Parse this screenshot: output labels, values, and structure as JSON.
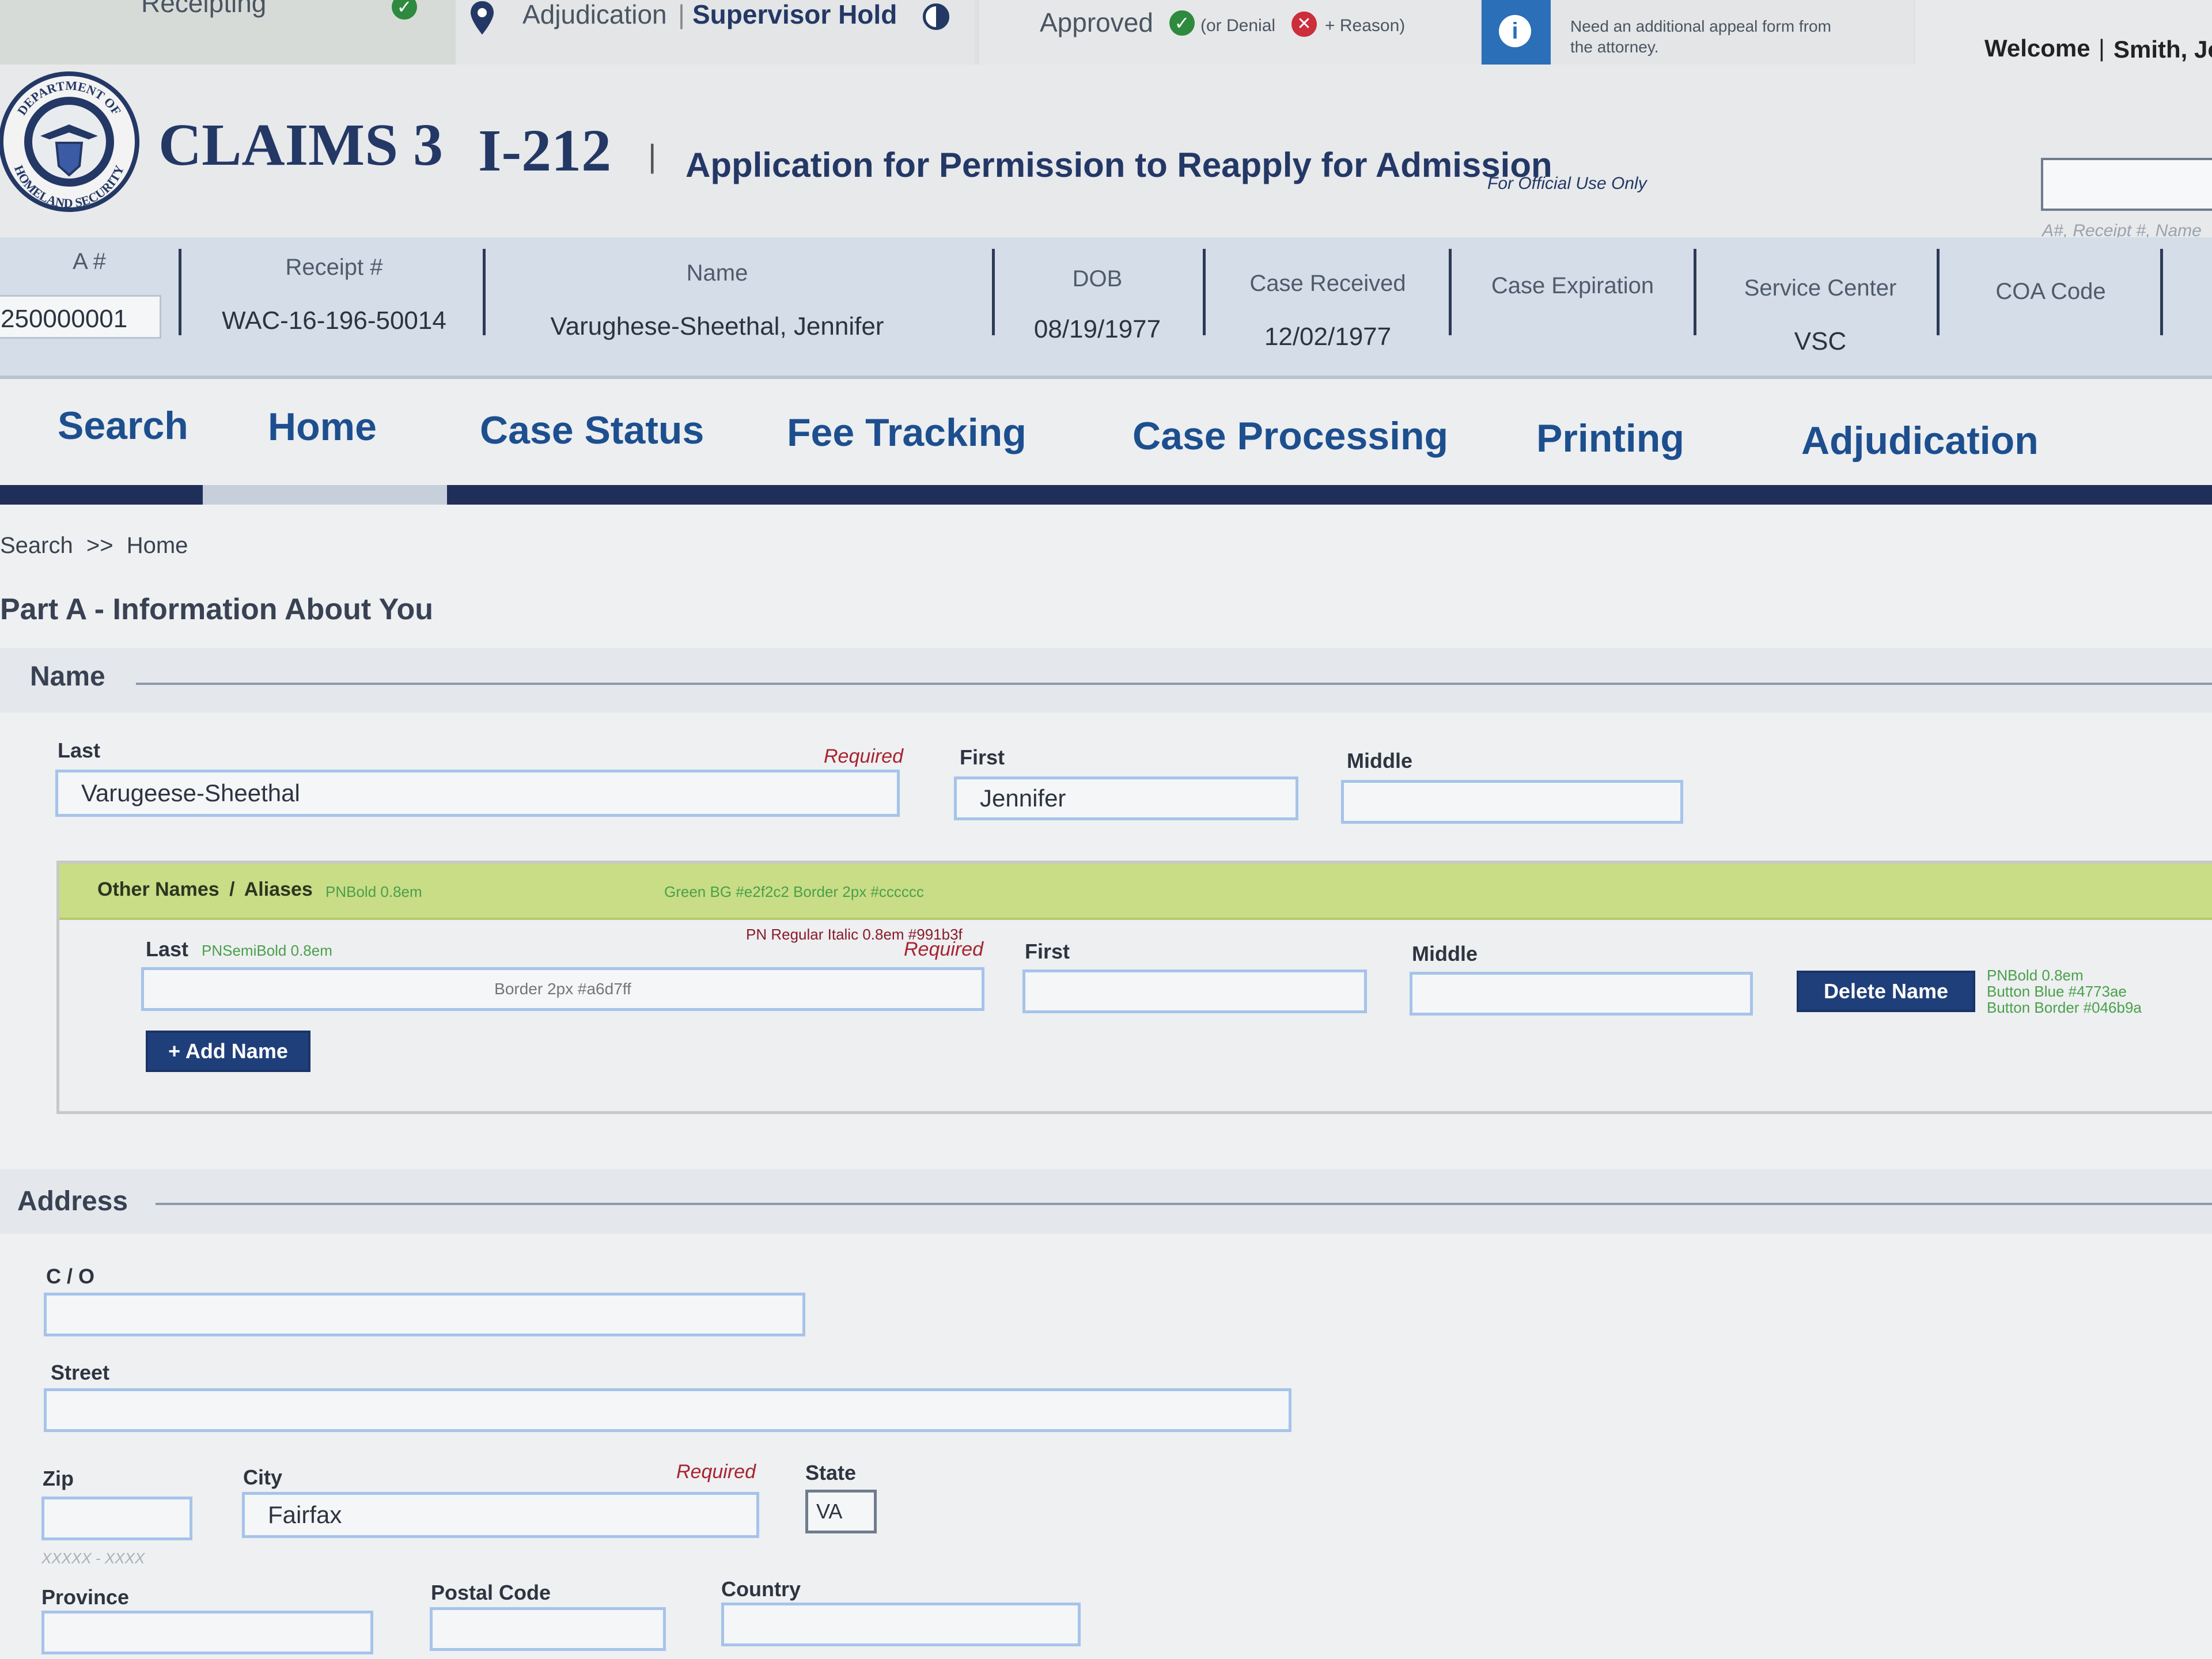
{
  "status_strip": {
    "receipting": "Receipting",
    "adjudication": "Adjudication",
    "separator": "|",
    "supervisor_hold": "Supervisor Hold",
    "approved": "Approved",
    "or_denial": "(or Denial",
    "reason": "+ Reason)",
    "notice_line1": "Need an additional appeal form from",
    "notice_line2": "the attorney.",
    "welcome": "Welcome",
    "welcome_sep": "|",
    "user": "Smith, Jo"
  },
  "header": {
    "system": "CLAIMS 3",
    "form": "I-212",
    "separator": "|",
    "subtitle": "Application for Permission to Reapply for Admission",
    "official": "For Official Use Only",
    "search_placeholder": "A#, Receipt #, Name",
    "seal_top": "DEPARTMENT OF",
    "seal_bottom": "HOMELAND SECURITY"
  },
  "case_info": {
    "a_label": "A #",
    "a_value": "250000001",
    "receipt_label": "Receipt #",
    "receipt_value": "WAC-16-196-50014",
    "name_label": "Name",
    "name_value": "Varughese-Sheethal, Jennifer",
    "dob_label": "DOB",
    "dob_value": "08/19/1977",
    "received_label": "Case Received",
    "received_value": "12/02/1977",
    "expiration_label": "Case Expiration",
    "expiration_value": "",
    "center_label": "Service Center",
    "center_value": "VSC",
    "coa_label": "COA Code",
    "coa_value": ""
  },
  "nav": {
    "items": [
      "Search",
      "Home",
      "Case Status",
      "Fee Tracking",
      "Case Processing",
      "Printing",
      "Adjudication"
    ]
  },
  "breadcrumb": {
    "search": "Search",
    "sep": ">>",
    "home": "Home"
  },
  "part_title": "Part A - Information About You",
  "name_section": {
    "title": "Name",
    "last_label": "Last",
    "required": "Required",
    "last_value": "Varugeese-Sheethal",
    "first_label": "First",
    "first_value": "Jennifer",
    "middle_label": "Middle",
    "middle_value": ""
  },
  "aliases": {
    "title_part1": "Other Names",
    "title_sep": "/",
    "title_part2": "Aliases",
    "note_font": "PNBold 0.8em",
    "note_bg": "Green BG #e2f2c2 Border 2px #cccccc",
    "last_label": "Last",
    "note_label_font": "PNSemiBold 0.8em",
    "note_required_font": "PN Regular Italic 0.8em #991b3f",
    "required": "Required",
    "last_placeholder": "Border 2px #a6d7ff",
    "first_label": "First",
    "middle_label": "Middle",
    "delete_button": "Delete Name",
    "note_btn1": "PNBold 0.8em",
    "note_btn2": "Button Blue #4773ae",
    "note_btn3": "Button Border #046b9a",
    "add_button": "+ Add Name"
  },
  "address": {
    "title": "Address",
    "co_label": "C / O",
    "co_value": "",
    "street_label": "Street",
    "street_value": "",
    "zip_label": "Zip",
    "zip_value": "",
    "zip_hint": "XXXXX - XXXX",
    "city_label": "City",
    "required": "Required",
    "city_value": "Fairfax",
    "state_label": "State",
    "state_value": "VA",
    "province_label": "Province",
    "province_value": "",
    "postal_label": "Postal Code",
    "postal_value": "",
    "country_label": "Country",
    "country_value": ""
  },
  "colors": {
    "brand_blue": "#243866",
    "nav_blue": "#1d4f8f",
    "required_red": "#a82430",
    "field_border": "#a6c3ea",
    "alias_green": "#c9dc86",
    "button_blue": "#1f3f7a"
  }
}
